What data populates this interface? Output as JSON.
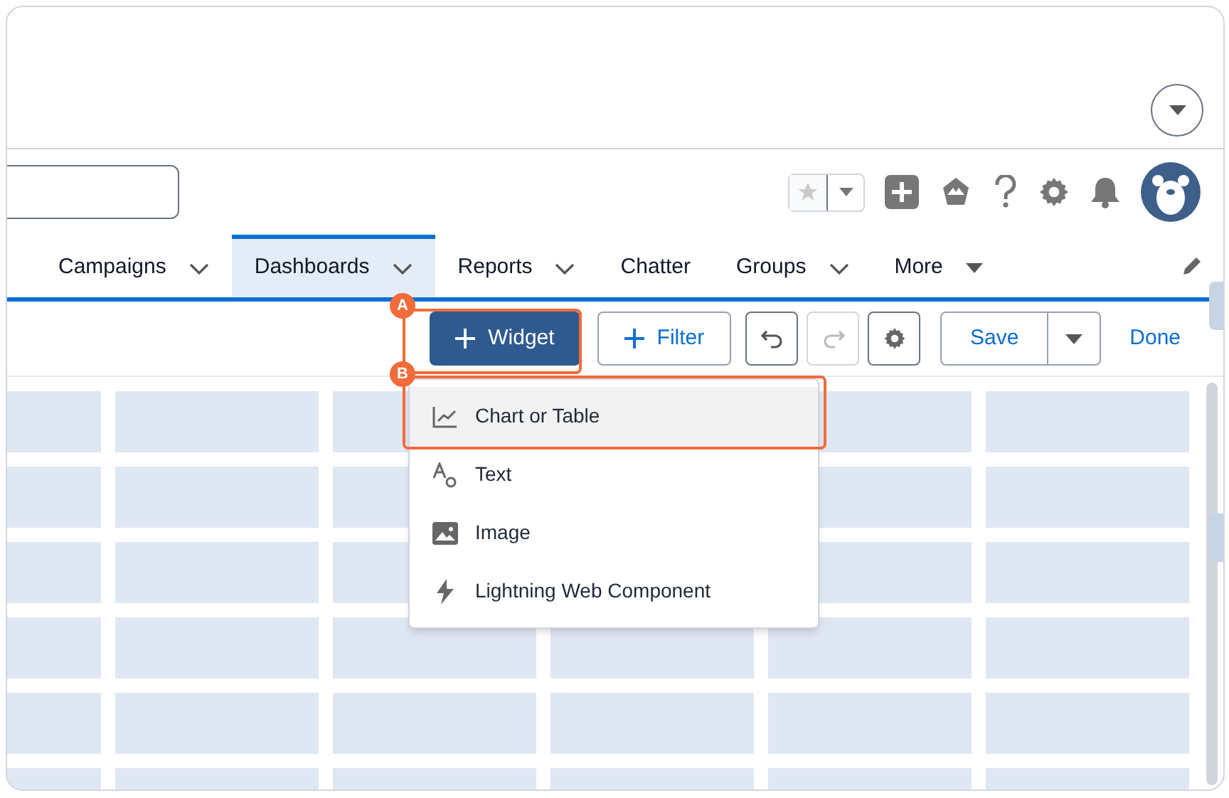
{
  "nav_tabs": [
    {
      "label": "Campaigns",
      "dropdown": true,
      "selected": false
    },
    {
      "label": "Dashboards",
      "dropdown": true,
      "selected": true
    },
    {
      "label": "Reports",
      "dropdown": true,
      "selected": false
    },
    {
      "label": "Chatter",
      "dropdown": false,
      "selected": false
    },
    {
      "label": "Groups",
      "dropdown": true,
      "selected": false
    },
    {
      "label": "More",
      "dropdown": true,
      "selected": false
    }
  ],
  "toolbar": {
    "widget_button": "Widget",
    "filter_button": "Filter",
    "save_button": "Save",
    "done_button": "Done"
  },
  "widget_menu": [
    {
      "kind": "chart",
      "label": "Chart or Table",
      "selected": true
    },
    {
      "kind": "text",
      "label": "Text",
      "selected": false
    },
    {
      "kind": "image",
      "label": "Image",
      "selected": false
    },
    {
      "kind": "bolt",
      "label": "Lightning Web Component",
      "selected": false
    }
  ],
  "callouts": [
    {
      "label": "A"
    },
    {
      "label": "B"
    }
  ]
}
